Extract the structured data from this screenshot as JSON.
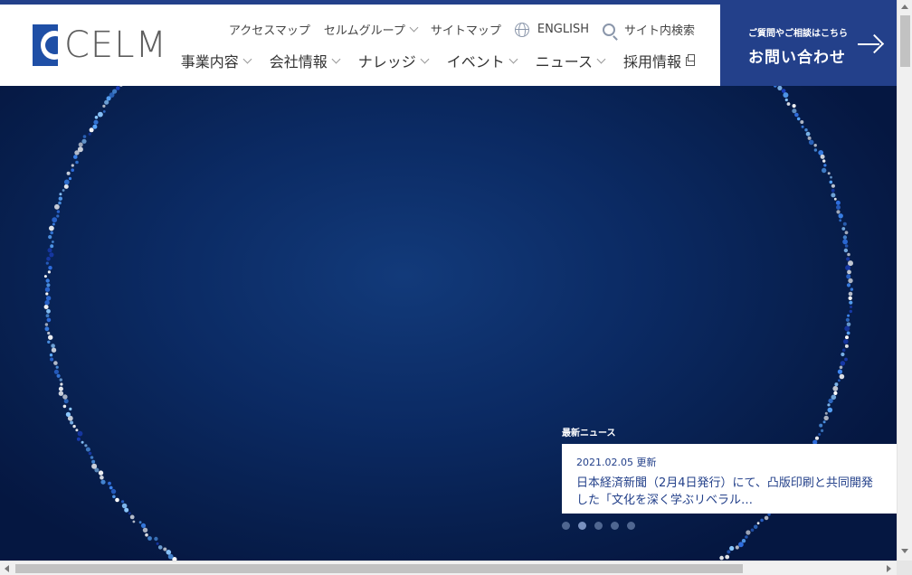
{
  "brand": {
    "logo_text": "CELM",
    "accent": "#23408a"
  },
  "util_nav": {
    "access_map": "アクセスマップ",
    "celm_group": "セルムグループ",
    "site_map": "サイトマップ",
    "english": "ENGLISH",
    "site_search": "サイト内検索"
  },
  "main_nav": {
    "business": "事業内容",
    "company": "会社情報",
    "knowledge": "ナレッジ",
    "events": "イベント",
    "news": "ニュース",
    "recruit": "採用情報"
  },
  "contact": {
    "small": "ご質問やご相談はこちら",
    "big": "お問い合わせ"
  },
  "news": {
    "label": "最新ニュース",
    "date": "2021.02.05 更新",
    "title": "日本経済新聞（2月4日発行）にて、凸版印刷と共同開発した「文化を深く学ぶリベラル…",
    "slides": 5,
    "active_slide": 2
  }
}
